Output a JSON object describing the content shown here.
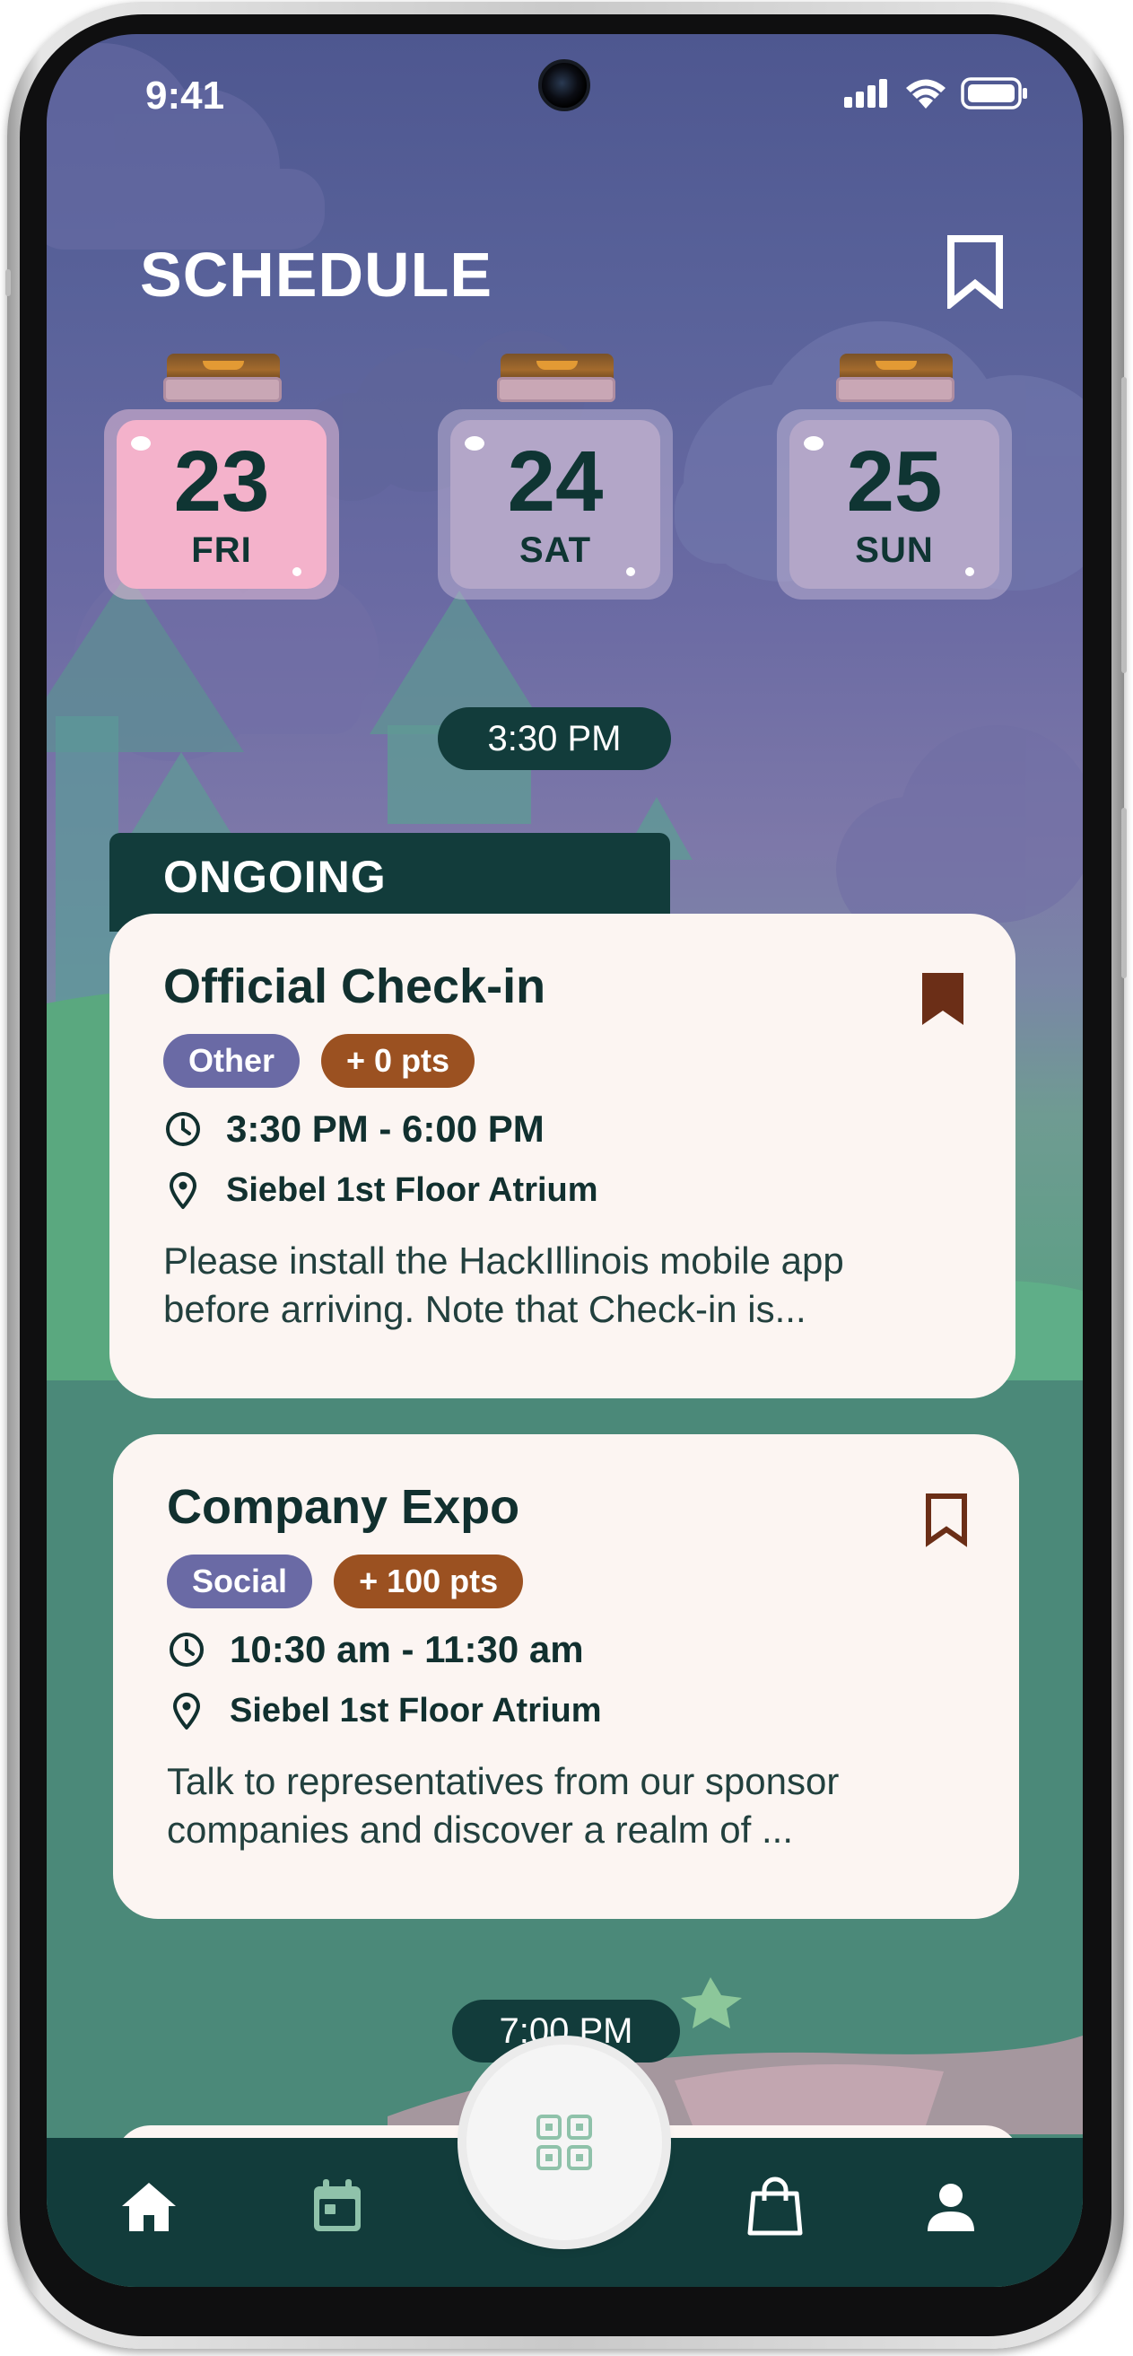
{
  "status_bar": {
    "time": "9:41",
    "icons": [
      "signal-icon",
      "wifi-icon",
      "battery-icon"
    ]
  },
  "header": {
    "title": "SCHEDULE",
    "bookmark_icon": "bookmark-outline-icon"
  },
  "dates": [
    {
      "number": "23",
      "day": "FRI",
      "selected": true
    },
    {
      "number": "24",
      "day": "SAT",
      "selected": false
    },
    {
      "number": "25",
      "day": "SUN",
      "selected": false
    }
  ],
  "time_slots": [
    "3:30 PM",
    "7:00 PM"
  ],
  "section_label": "ONGOING",
  "events": [
    {
      "title": "Official Check-in",
      "category": "Other",
      "points": "+ 0 pts",
      "time": "3:30 PM - 6:00 PM",
      "location": "Siebel 1st Floor Atrium",
      "description_line1": "Please install the HackIllinois mobile app",
      "description_line2": "before arriving. Note that Check-in is...",
      "bookmarked": true
    },
    {
      "title": "Company Expo",
      "category": "Social",
      "points": "+ 100 pts",
      "time": "10:30 am - 11:30 am",
      "location": "Siebel 1st Floor Atrium",
      "description_line1": "Talk to representatives from our sponsor",
      "description_line2": "companies and discover a realm of ...",
      "bookmarked": false
    }
  ],
  "nav": {
    "items": [
      "home-icon",
      "calendar-icon",
      "qr-code-icon",
      "shop-bag-icon",
      "profile-icon"
    ],
    "active": "calendar-icon"
  },
  "colors": {
    "dark_teal": "#123c3b",
    "card_bg": "#fcf5f2",
    "selected_date": "#f4b2cb",
    "unselected_date": "#b3a6c8",
    "category_tag": "#6a6aa5",
    "points_tag": "#9b5121",
    "bookmark_fill": "#6b2e17"
  }
}
